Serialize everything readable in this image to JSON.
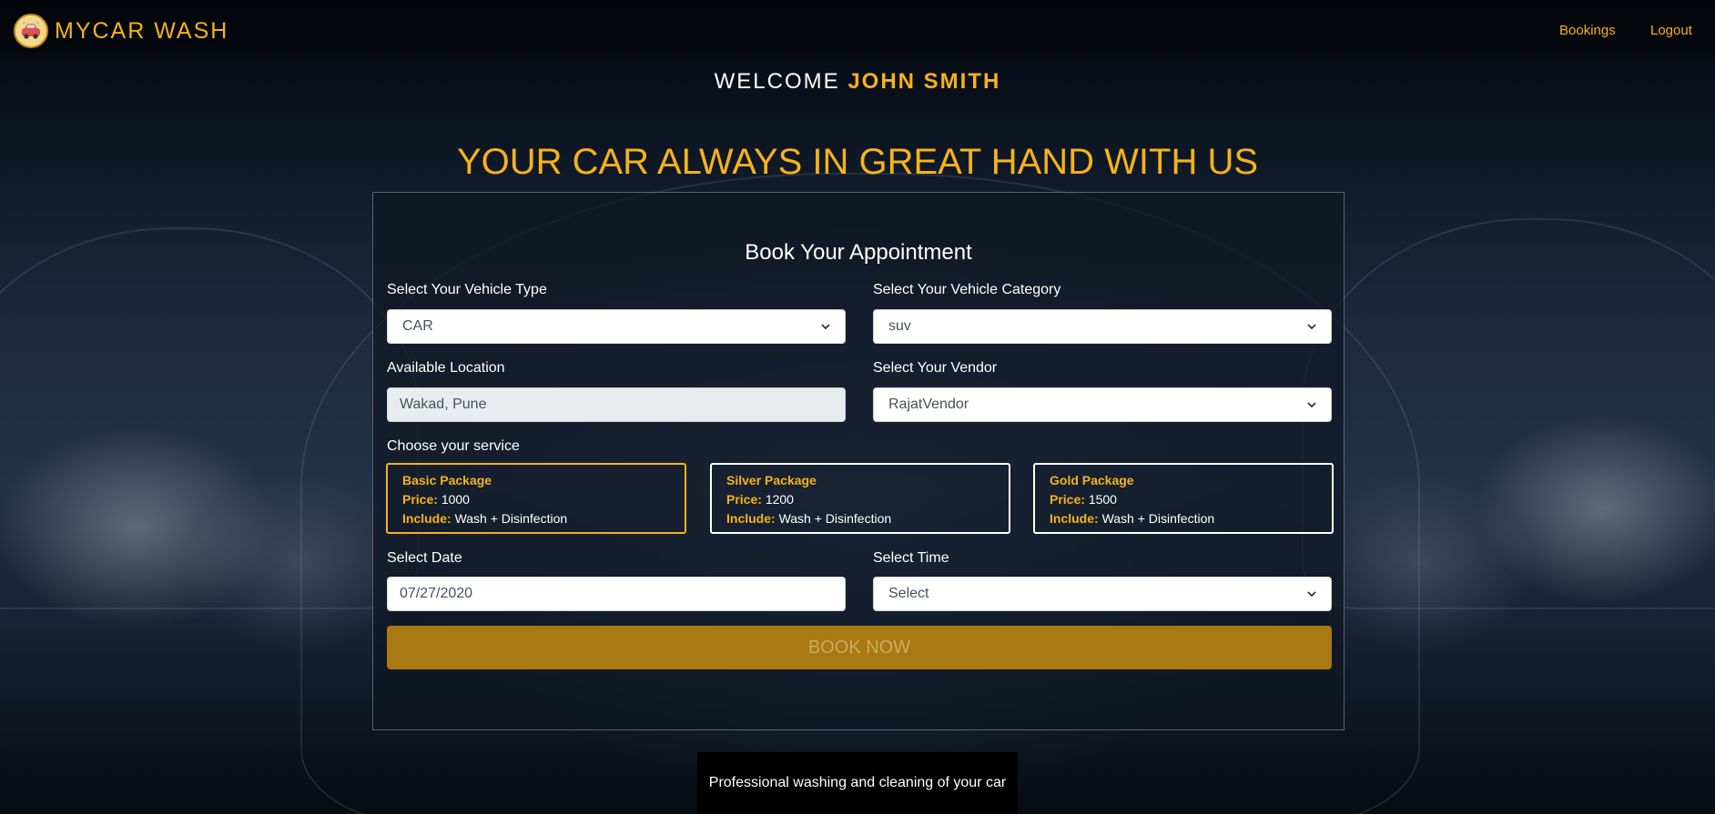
{
  "brand": {
    "name": "MYCAR WASH",
    "logo_icon": "car-wash-logo-icon"
  },
  "nav": {
    "bookings": "Bookings",
    "logout": "Logout"
  },
  "welcome": {
    "prefix": "WELCOME",
    "user": "JOHN SMITH"
  },
  "hero": "YOUR CAR ALWAYS IN GREAT HAND WITH US",
  "form": {
    "title": "Book Your Appointment",
    "vehicle_type": {
      "label": "Select Your Vehicle Type",
      "value": "CAR"
    },
    "vehicle_category": {
      "label": "Select Your Vehicle Category",
      "value": "suv"
    },
    "location": {
      "label": "Available Location",
      "value": "Wakad, Pune"
    },
    "vendor": {
      "label": "Select Your Vendor",
      "value": "RajatVendor"
    },
    "service_label": "Choose your service",
    "packages": [
      {
        "name": "Basic Package",
        "price_key": "Price:",
        "price": "1000",
        "include_key": "Include:",
        "include": "Wash + Disinfection",
        "selected": true
      },
      {
        "name": "Silver Package",
        "price_key": "Price:",
        "price": "1200",
        "include_key": "Include:",
        "include": "Wash + Disinfection",
        "selected": false
      },
      {
        "name": "Gold Package",
        "price_key": "Price:",
        "price": "1500",
        "include_key": "Include:",
        "include": "Wash + Disinfection",
        "selected": false
      }
    ],
    "date": {
      "label": "Select Date",
      "value": "07/27/2020"
    },
    "time": {
      "label": "Select Time",
      "value": "Select"
    },
    "submit": "BOOK NOW"
  },
  "footer": "Professional washing and cleaning of your car",
  "colors": {
    "accent": "#f5b21b",
    "button": "#a87a11",
    "background": "#0b1220"
  }
}
